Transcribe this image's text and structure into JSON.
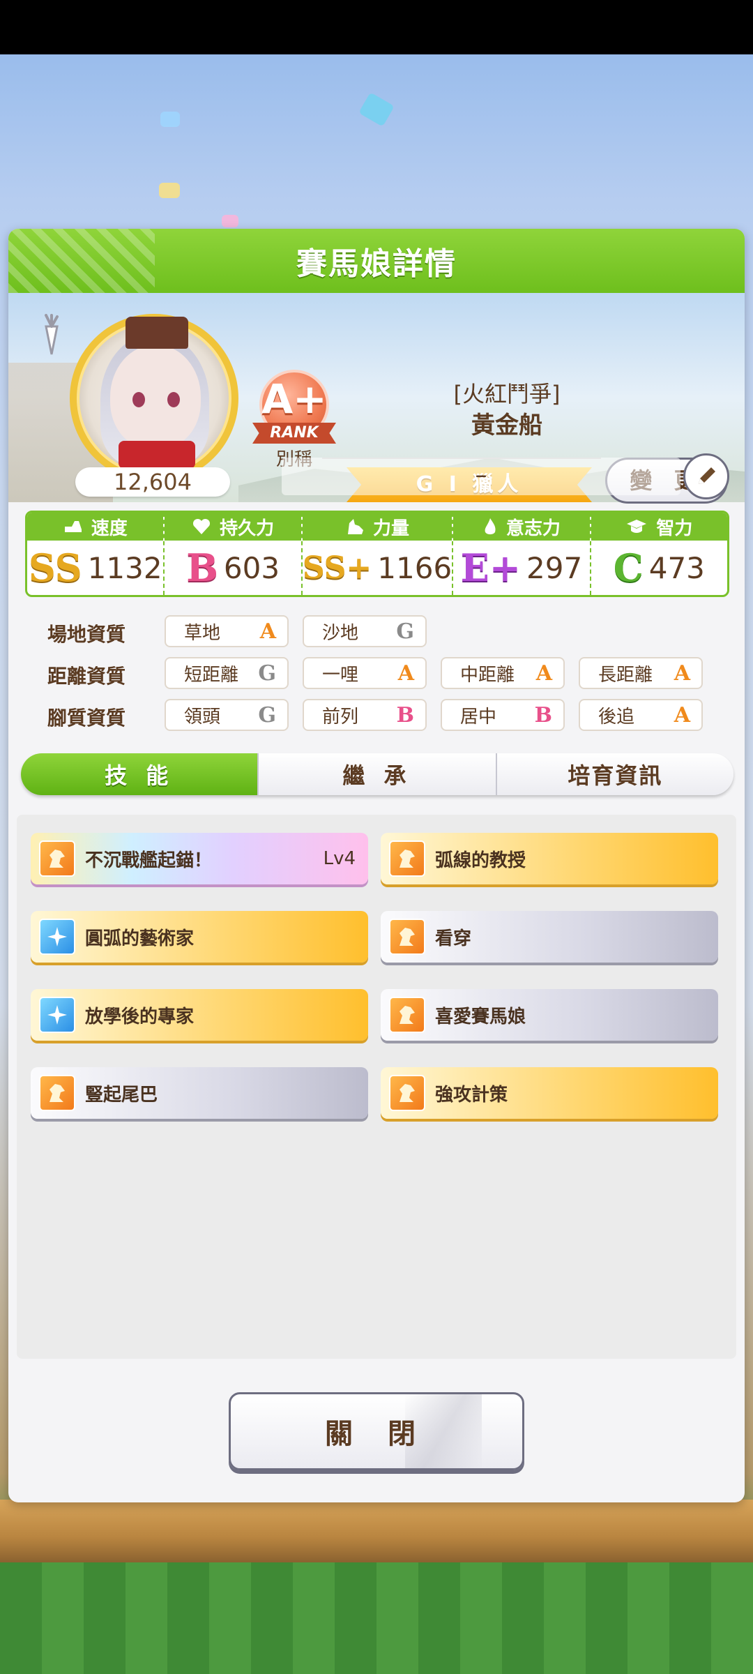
{
  "panel": {
    "title": "賽馬娘詳情"
  },
  "profile": {
    "fans": "12,604",
    "rank": "A+",
    "rank_word": "RANK",
    "nickname_label": "別稱",
    "epithet": "[火紅鬥爭]",
    "name": "黃金船",
    "title": "G I 獵人",
    "change_label": "變 更",
    "comment": "–"
  },
  "stats": [
    {
      "label": "速度",
      "grade": "SS",
      "value": "1132",
      "icon": "shoe-icon",
      "color": "#e6a820"
    },
    {
      "label": "持久力",
      "grade": "B",
      "value": "603",
      "icon": "heart-icon",
      "color": "#e8508a"
    },
    {
      "label": "力量",
      "grade": "SS+",
      "value": "1166",
      "icon": "muscle-icon",
      "color": "#e6a820"
    },
    {
      "label": "意志力",
      "grade": "E+",
      "value": "297",
      "icon": "flame-icon",
      "color": "#b34ad8"
    },
    {
      "label": "智力",
      "grade": "C",
      "value": "473",
      "icon": "graduation-cap-icon",
      "color": "#5cb531"
    }
  ],
  "aptitudes": {
    "track_label": "場地資質",
    "distance_label": "距離資質",
    "style_label": "腳質資質",
    "track": [
      {
        "name": "草地",
        "grade": "A"
      },
      {
        "name": "沙地",
        "grade": "G"
      }
    ],
    "distance": [
      {
        "name": "短距離",
        "grade": "G"
      },
      {
        "name": "一哩",
        "grade": "A"
      },
      {
        "name": "中距離",
        "grade": "A"
      },
      {
        "name": "長距離",
        "grade": "A"
      }
    ],
    "style": [
      {
        "name": "領頭",
        "grade": "G"
      },
      {
        "name": "前列",
        "grade": "B"
      },
      {
        "name": "居中",
        "grade": "B"
      },
      {
        "name": "後追",
        "grade": "A"
      }
    ]
  },
  "grade_colors": {
    "A": "#f08a1c",
    "B": "#e8508a",
    "G": "#8a8a8a"
  },
  "tabs": [
    "技 能",
    "繼 承",
    "培育資訊"
  ],
  "skills": [
    {
      "name": "不沉戰艦起錨！",
      "level": "Lv4",
      "style": "rainbow",
      "icon": "orange"
    },
    {
      "name": "弧線的教授",
      "level": "",
      "style": "gold",
      "icon": "orange"
    },
    {
      "name": "圓弧的藝術家",
      "level": "",
      "style": "gold",
      "icon": "blue"
    },
    {
      "name": "看穿",
      "level": "",
      "style": "white",
      "icon": "orange"
    },
    {
      "name": "放學後的專家",
      "level": "",
      "style": "gold",
      "icon": "blue"
    },
    {
      "name": "喜愛賽馬娘",
      "level": "",
      "style": "white",
      "icon": "orange"
    },
    {
      "name": "豎起尾巴",
      "level": "",
      "style": "white",
      "icon": "orange"
    },
    {
      "name": "強攻計策",
      "level": "",
      "style": "gold",
      "icon": "orange"
    }
  ],
  "close_label": "關 閉"
}
